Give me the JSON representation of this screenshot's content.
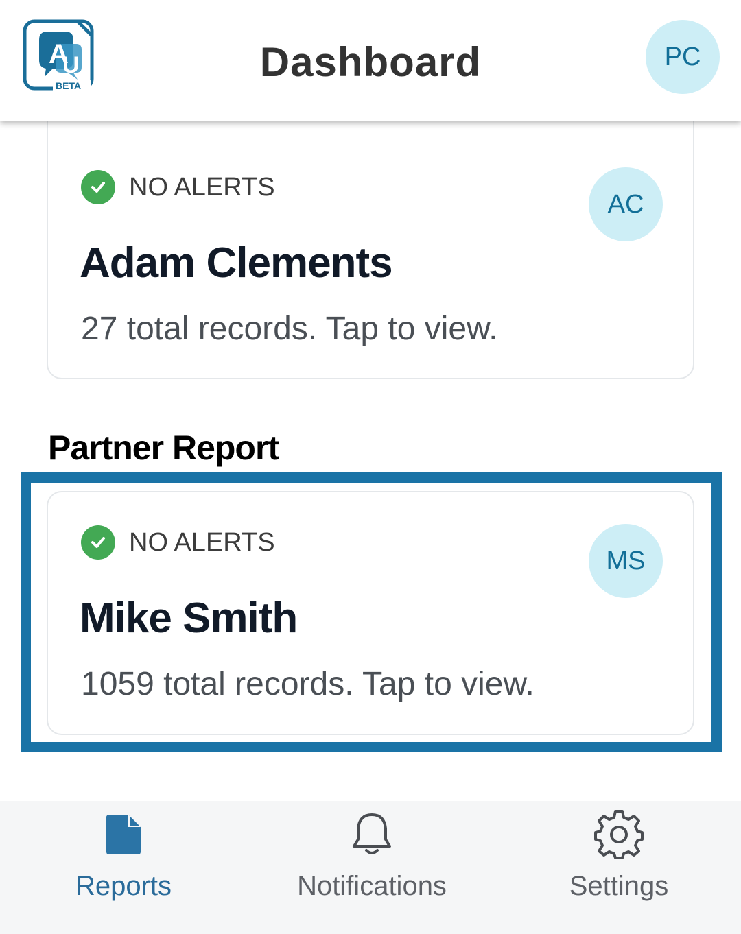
{
  "header": {
    "title": "Dashboard",
    "logo_letters": "AU",
    "logo_badge": "BETA",
    "user_initials": "PC"
  },
  "cards": [
    {
      "status": "NO ALERTS",
      "name": "Adam Clements",
      "initials": "AC",
      "records_text": "27 total records. Tap to view."
    },
    {
      "status": "NO ALERTS",
      "name": "Mike Smith",
      "initials": "MS",
      "records_text": "1059 total records. Tap to view."
    }
  ],
  "section": {
    "partner_heading": "Partner Report"
  },
  "nav": {
    "items": [
      {
        "label": "Reports",
        "icon": "document-icon",
        "active": true
      },
      {
        "label": "Notifications",
        "icon": "bell-icon",
        "active": false
      },
      {
        "label": "Settings",
        "icon": "gear-icon",
        "active": false
      }
    ]
  },
  "colors": {
    "accent": "#1a73a6",
    "avatar_bg": "#cdeef6",
    "avatar_text": "#126f98",
    "success": "#43a954"
  }
}
